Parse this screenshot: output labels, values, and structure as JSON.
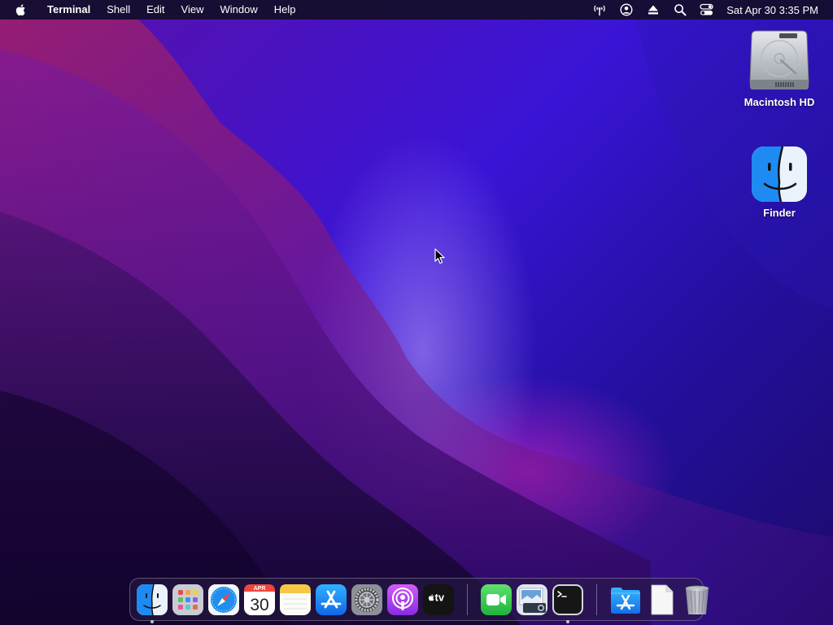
{
  "menubar": {
    "app_name": "Terminal",
    "menus": [
      "Shell",
      "Edit",
      "View",
      "Window",
      "Help"
    ],
    "clock": "Sat Apr 30  3:35 PM",
    "status_icons": [
      "antenna-icon",
      "user-account-icon",
      "eject-icon",
      "spotlight-search-icon",
      "control-center-icon"
    ]
  },
  "desktop_icons": [
    {
      "label": "Macintosh HD",
      "icon": "hard-drive-icon"
    },
    {
      "label": "Finder",
      "icon": "finder-icon"
    }
  ],
  "dock": {
    "apps": [
      "Finder",
      "Launchpad",
      "Safari",
      "Calendar",
      "Notes",
      "App Store",
      "System Preferences",
      "Podcasts",
      "TV"
    ],
    "recent_apps": [
      "FaceTime",
      "Preview",
      "Terminal"
    ],
    "others": [
      "Applications",
      "Document",
      "Trash"
    ],
    "calendar_month": "APR",
    "calendar_day": "30",
    "tv_label": "tv"
  },
  "colors": {
    "menubar": "#140e28",
    "wallpaper_primary": "#3a14d6",
    "wallpaper_accent": "#e028c8"
  }
}
